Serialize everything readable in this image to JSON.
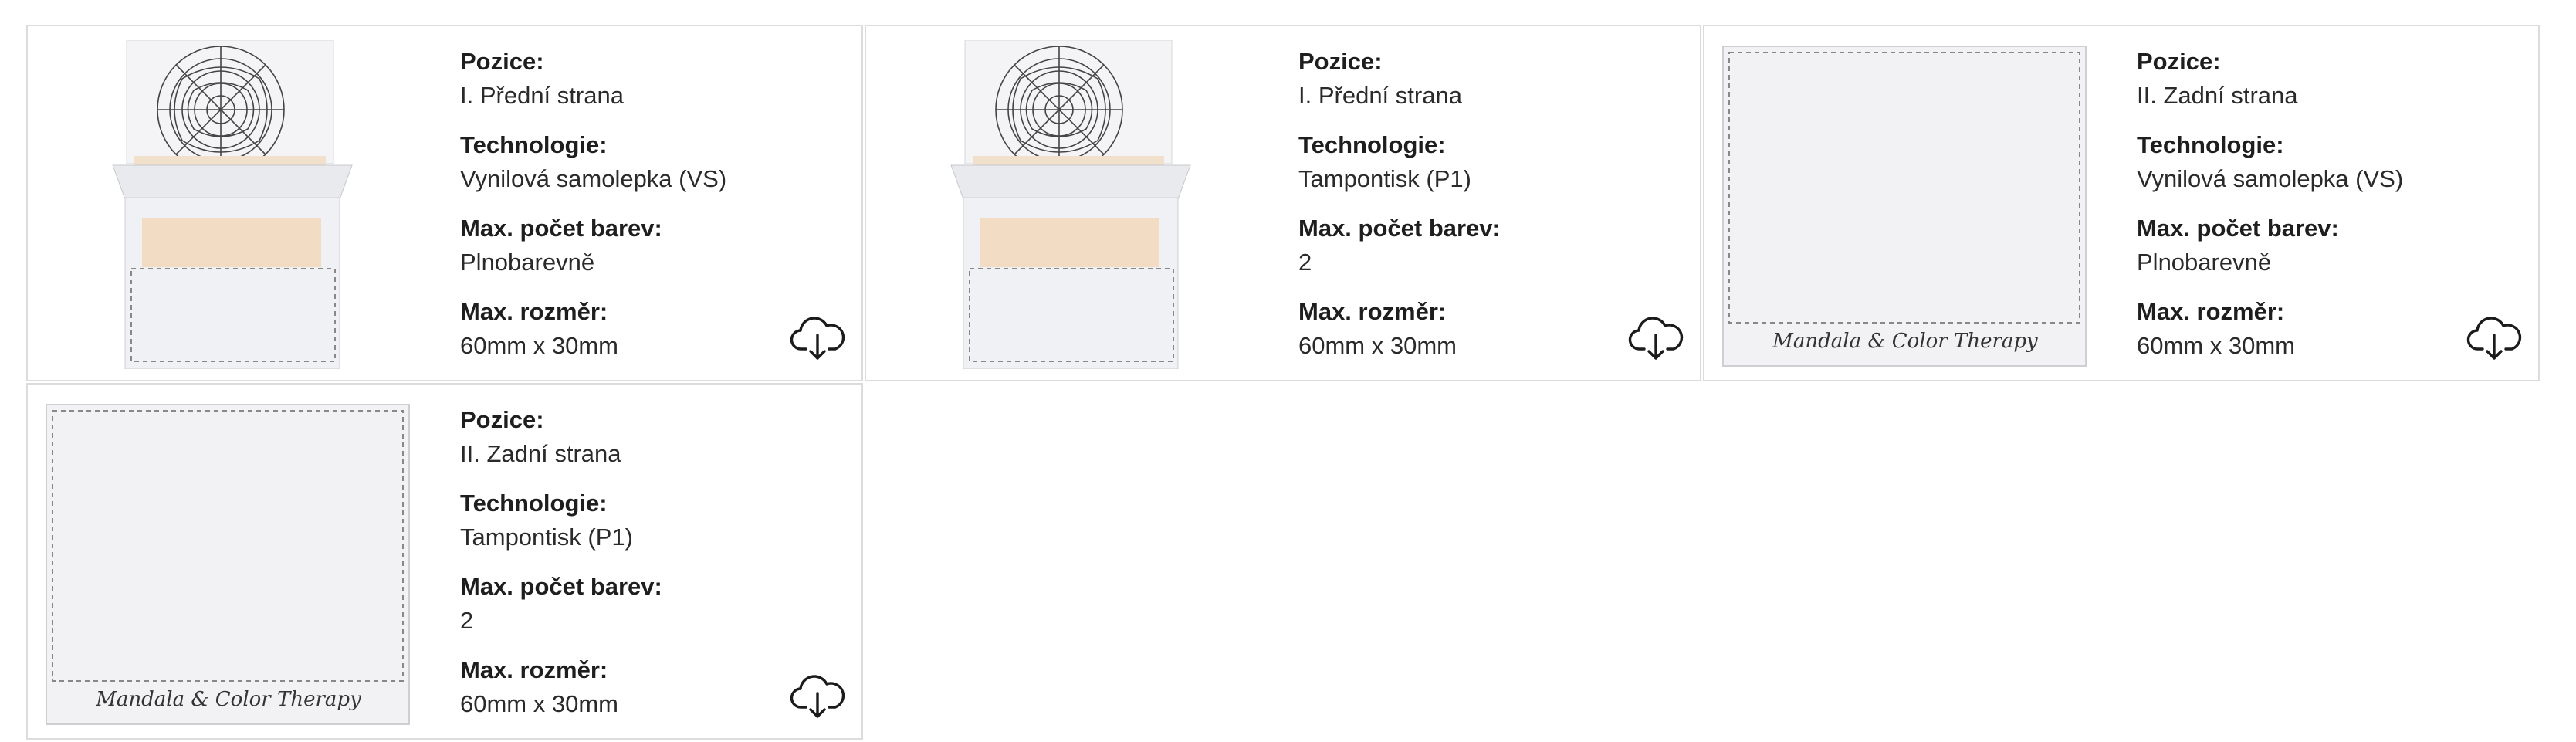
{
  "labels": {
    "position": "Pozice:",
    "technology": "Technologie:",
    "max_colors": "Max. počet barev:",
    "max_size": "Max. rozměr:"
  },
  "cards": [
    {
      "position": "I. Přední strana",
      "technology": "Vynilová samolepka (VS)",
      "max_colors": "Plnobarevně",
      "max_size": "60mm x 30mm",
      "image": "front-pencil-box",
      "download_icon": "cloud-download-icon"
    },
    {
      "position": "I. Přední strana",
      "technology": "Tampontisk (P1)",
      "max_colors": "2",
      "max_size": "60mm x 30mm",
      "image": "front-pencil-box",
      "download_icon": "cloud-download-icon"
    },
    {
      "position": "II. Zadní strana",
      "technology": "Vynilová samolepka (VS)",
      "max_colors": "Plnobarevně",
      "max_size": "60mm x 30mm",
      "image": "back-pencil-box",
      "download_icon": "cloud-download-icon"
    },
    {
      "position": "II. Zadní strana",
      "technology": "Tampontisk (P1)",
      "max_colors": "2",
      "max_size": "60mm x 30mm",
      "image": "back-pencil-box",
      "download_icon": "cloud-download-icon"
    }
  ],
  "product_print_text": "Mandala & Color Therapy"
}
